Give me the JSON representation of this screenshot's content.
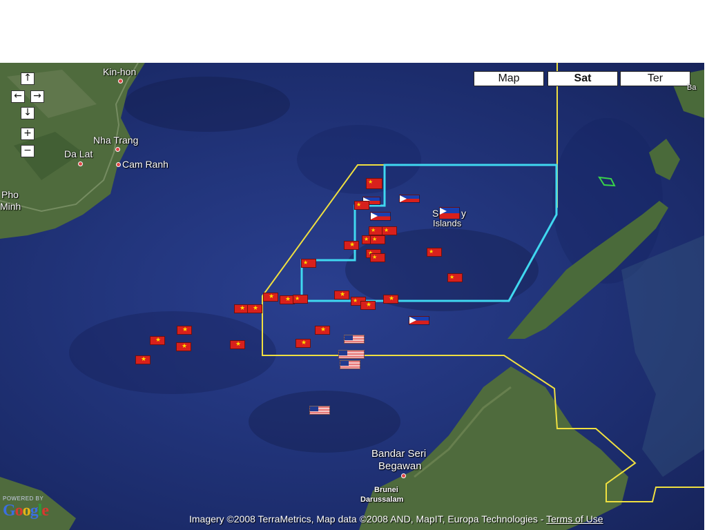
{
  "map_type": {
    "map_label": "Map",
    "sat_label": "Sat",
    "ter_label": "Ter",
    "active": "Sat"
  },
  "controls": {
    "pan_up": "↑",
    "pan_left": "←",
    "pan_right": "→",
    "pan_down": "↓",
    "zoom_in": "+",
    "zoom_out": "−"
  },
  "places": {
    "kin_hon": "Kin-hon",
    "nha_trang": "Nha Trang",
    "da_lat": "Da Lat",
    "cam_ranh": "Cam Ranh",
    "pho": "Pho",
    "minh": "Minh",
    "spratly_1": "S",
    "spratly_2": "y",
    "spratly_3": "Islands",
    "bandar_1": "Bandar Seri",
    "bandar_2": "Begawan",
    "brunei_1": "Brunei",
    "brunei_2": "Darussalam",
    "ba": "Ba"
  },
  "attribution": {
    "text": "Imagery ©2008 TerraMetrics, Map data ©2008 AND, MapIT, Europa Technologies - ",
    "terms": "Terms of Use"
  },
  "powered_by": "POWERED BY",
  "logo": [
    "G",
    "o",
    "o",
    "g",
    "l",
    "e"
  ],
  "colors": {
    "ocean": "#22357c",
    "claim_line": "#f0e040",
    "spratly_box": "#40d8f0",
    "land": "#4a6a3a"
  }
}
